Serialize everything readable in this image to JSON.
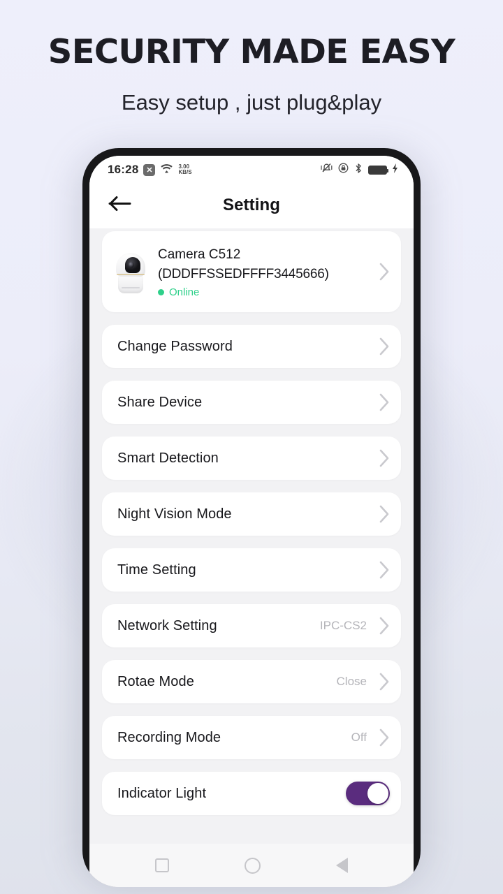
{
  "promo": {
    "title": "SECURITY MADE EASY",
    "subtitle": "Easy setup , just plug&play"
  },
  "colors": {
    "accent_purple": "#5A2C7E",
    "online_green": "#2ED08A",
    "page_bg": "#F2F2F4",
    "card_bg": "#FFFFFF",
    "text_primary": "#17171B",
    "text_muted": "#B4B4B9"
  },
  "statusbar": {
    "time": "16:28",
    "x_badge": "✕",
    "net_speed_value": "3.00",
    "net_speed_unit": "KB/S",
    "icons": [
      "wifi-icon",
      "vibrate-icon",
      "dnd-lock-icon",
      "bluetooth-icon",
      "battery-charging-icon"
    ]
  },
  "appbar": {
    "back_icon": "arrow-left-icon",
    "title": "Setting"
  },
  "device": {
    "thumbnail": "camera-thumbnail",
    "name": "Camera C512",
    "id": "(DDDFFSSEDFFFF3445666)",
    "status": "Online",
    "chevron": "chevron-right-icon"
  },
  "rows": [
    {
      "label": "Change Password",
      "value": "",
      "control": "chevron"
    },
    {
      "label": "Share Device",
      "value": "",
      "control": "chevron"
    },
    {
      "label": "Smart Detection",
      "value": "",
      "control": "chevron"
    },
    {
      "label": "Night Vision Mode",
      "value": "",
      "control": "chevron"
    },
    {
      "label": "Time Setting",
      "value": "",
      "control": "chevron"
    },
    {
      "label": "Network Setting",
      "value": "IPC-CS2",
      "control": "chevron"
    },
    {
      "label": "Rotae Mode",
      "value": "Close",
      "control": "chevron"
    },
    {
      "label": "Recording Mode",
      "value": "Off",
      "control": "chevron"
    },
    {
      "label": "Indicator Light",
      "value": "",
      "control": "toggle",
      "toggle_on": true
    }
  ],
  "navbar": {
    "recents": "square-icon",
    "home": "circle-icon",
    "back": "triangle-left-icon"
  }
}
